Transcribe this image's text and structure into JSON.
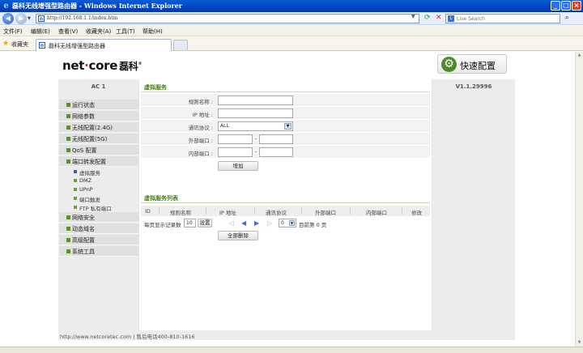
{
  "window": {
    "title": "磊科无线增强型路由器 - Windows Internet Explorer",
    "buttons": [
      "_",
      "□",
      "×"
    ]
  },
  "address_bar": {
    "url": "http://192.168.1.1/index.htm",
    "search_placeholder": "Live Search"
  },
  "menubar": {
    "items": [
      "文件(F)",
      "编辑(E)",
      "查看(V)",
      "收藏夹(A)",
      "工具(T)",
      "帮助(H)"
    ]
  },
  "favbar": {
    "favorites_label": "收藏夹",
    "tab_title": "磊科无线增强型路由器"
  },
  "header": {
    "logo_brand": "net",
    "logo_dot": "·",
    "logo_brand2": "core",
    "logo_cn": "磊科",
    "logo_reg": "®",
    "quick_setup": "快速配置",
    "gear_glyph": "⚙"
  },
  "sidebar": {
    "model": "AC 1",
    "items": [
      {
        "label": "运行状态"
      },
      {
        "label": "网络参数"
      },
      {
        "label": "无线配置(2.4G)"
      },
      {
        "label": "无线配置(5G)"
      },
      {
        "label": "QoS 配置"
      },
      {
        "label": "端口转发配置"
      }
    ],
    "sub_items": [
      {
        "label": "虚拟服务"
      },
      {
        "label": "DMZ"
      },
      {
        "label": "UPnP"
      },
      {
        "label": "端口触发"
      },
      {
        "label": "FTP 私有端口"
      }
    ],
    "items_after": [
      {
        "label": "网络安全"
      },
      {
        "label": "动态域名"
      },
      {
        "label": "高级配置"
      },
      {
        "label": "系统工具"
      }
    ]
  },
  "version": "V1.1.29996",
  "virtual_service": {
    "title": "虚拟服务",
    "fields": {
      "rule_name": "规则名称 :",
      "ip_address": "IP 地址 :",
      "protocol": "通讯协议 :",
      "protocol_value": "ALL",
      "external_port": "外部端口 :",
      "internal_port": "内部端口 :",
      "dash": "-"
    },
    "add_button": "增加"
  },
  "list": {
    "title": "虚拟服务列表",
    "columns": [
      "ID",
      "规则名称",
      "IP 地址",
      "通讯协议",
      "外部端口",
      "内部端口",
      "修改"
    ],
    "per_page_label": "每页显示记录数",
    "per_page_value": "10",
    "set_button": "设置",
    "page_value": "0",
    "page_info": "目前第 0 页",
    "delete_all_button": "全部删除"
  },
  "footer": {
    "text": "http://www.netcoretec.com | 售后电话400-810-1616"
  }
}
